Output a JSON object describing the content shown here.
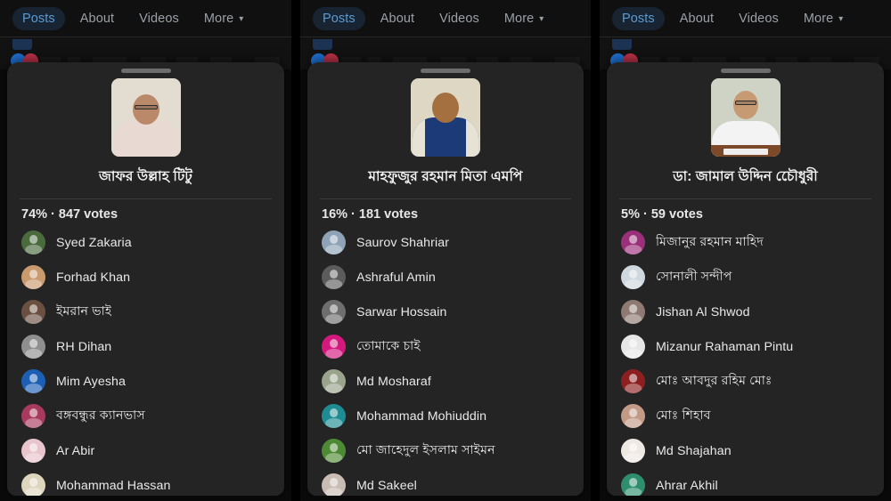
{
  "nav": {
    "tabs": [
      {
        "label": "Posts",
        "active": true
      },
      {
        "label": "About",
        "active": false
      },
      {
        "label": "Videos",
        "active": false
      },
      {
        "label": "More",
        "active": false,
        "caret": "▾"
      }
    ]
  },
  "panels": [
    {
      "candidate_name": "জাফর উল্লাহ টিটু",
      "tally": "74% · 847 votes",
      "percent": "74%",
      "votes": "847 votes",
      "photo": {
        "wall": "#e3ddd1",
        "skin": "#b9896a",
        "shirt": "#e8d9d2",
        "glasses": true
      },
      "voters": [
        {
          "name": "Syed Zakaria",
          "avatar": "#4a6b3c"
        },
        {
          "name": "Forhad Khan",
          "avatar": "#c99a6e"
        },
        {
          "name": "ইমরান ভাই",
          "avatar": "#6b5042"
        },
        {
          "name": "RH Dihan",
          "avatar": "#8f8f8f"
        },
        {
          "name": "Mim Ayesha",
          "avatar": "#1c5fb5"
        },
        {
          "name": "বঙ্গবন্ধুর ক্যানভাস",
          "avatar": "#a83a5e"
        },
        {
          "name": "Ar Abir",
          "avatar": "#e8c4cd"
        },
        {
          "name": "Mohammad Hassan",
          "avatar": "#ded6bc"
        }
      ]
    },
    {
      "candidate_name": "মাহফুজুর রহমান মিতা এমপি",
      "tally": "16% · 181 votes",
      "percent": "16%",
      "votes": "181 votes",
      "photo": {
        "wall": "#ddd7c4",
        "skin": "#a5703f",
        "shirt": "#1d3a78",
        "glasses": false
      },
      "voters": [
        {
          "name": "Saurov Shahriar",
          "avatar": "#8ea3b8"
        },
        {
          "name": "Ashraful Amin",
          "avatar": "#5c5c5c"
        },
        {
          "name": "Sarwar Hossain",
          "avatar": "#6e6e6e"
        },
        {
          "name": "তোমাকে চাই",
          "avatar": "#d4187e"
        },
        {
          "name": "Md Mosharaf",
          "avatar": "#9aa48c"
        },
        {
          "name": "Mohammad Mohiuddin",
          "avatar": "#1e8c93"
        },
        {
          "name": "মো জাহেদুল ইসলাম সাইমন",
          "avatar": "#4d8a34"
        },
        {
          "name": "Md Sakeel",
          "avatar": "#c9bcb4"
        }
      ]
    },
    {
      "candidate_name": "ডা: জামাল উদ্দিন চেৌধুরী",
      "tally": "5% · 59 votes",
      "percent": "5%",
      "votes": "59 votes",
      "photo": {
        "wall": "#cfd3c6",
        "skin": "#c69b74",
        "shirt": "#f3f3f3",
        "glasses": true
      },
      "voters": [
        {
          "name": "মিজানুর রহমান মাহিদ",
          "avatar": "#9b2f7a"
        },
        {
          "name": "সোনালী সন্দীপ",
          "avatar": "#cfd8de"
        },
        {
          "name": "Jishan Al Shwod",
          "avatar": "#8e7a72"
        },
        {
          "name": "Mizanur Rahaman Pintu",
          "avatar": "#e6e6e6"
        },
        {
          "name": "মোঃ আবদুর রহিম মোঃ",
          "avatar": "#8d1f20"
        },
        {
          "name": "মোঃ শিহাব",
          "avatar": "#c39a86"
        },
        {
          "name": "Md Shajahan",
          "avatar": "#efe9e3"
        },
        {
          "name": "Ahrar Akhil",
          "avatar": "#2e8f6e"
        }
      ]
    }
  ],
  "colors": {
    "accent": "#5b9bd5",
    "sheet_bg": "#242424",
    "page_bg": "#000000",
    "text_primary": "#e9e9e9",
    "text_muted": "#9aa0a6"
  }
}
